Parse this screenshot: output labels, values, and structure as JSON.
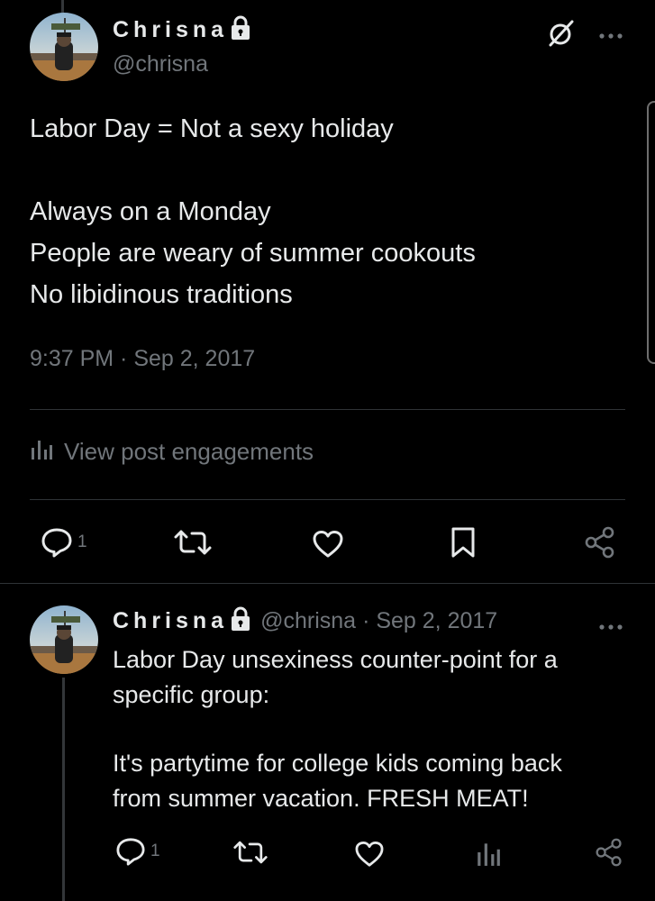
{
  "main_post": {
    "author_name": "Chrisna",
    "author_handle": "@chrisna",
    "text_lines": [
      "Labor Day = Not a sexy holiday",
      "",
      "Always on a Monday",
      "People are weary of summer cookouts",
      "No libidinous traditions"
    ],
    "timestamp": "9:37 PM · Sep 2, 2017",
    "engagements_label": "View post engagements",
    "actions": {
      "reply_count": "1",
      "repost_count": "",
      "like_count": ""
    }
  },
  "reply_post": {
    "author_name": "Chrisna",
    "author_handle": "@chrisna",
    "date": "· Sep 2, 2017",
    "text_lines": [
      "Labor Day unsexiness counter-point for a",
      "specific group:",
      "",
      "It's partytime for college kids coming back",
      "from summer vacation. FRESH MEAT!"
    ],
    "actions": {
      "reply_count": "1"
    }
  },
  "colors": {
    "background": "#000000",
    "text_primary": "#e7e9ea",
    "text_secondary": "#71767b",
    "divider": "#2f3336"
  },
  "icons": {
    "lock": "lock-icon",
    "grok": "grok-icon",
    "more": "more-icon",
    "reply": "reply-icon",
    "repost": "repost-icon",
    "like": "heart-icon",
    "bookmark": "bookmark-icon",
    "share": "share-icon",
    "analytics": "analytics-icon"
  }
}
